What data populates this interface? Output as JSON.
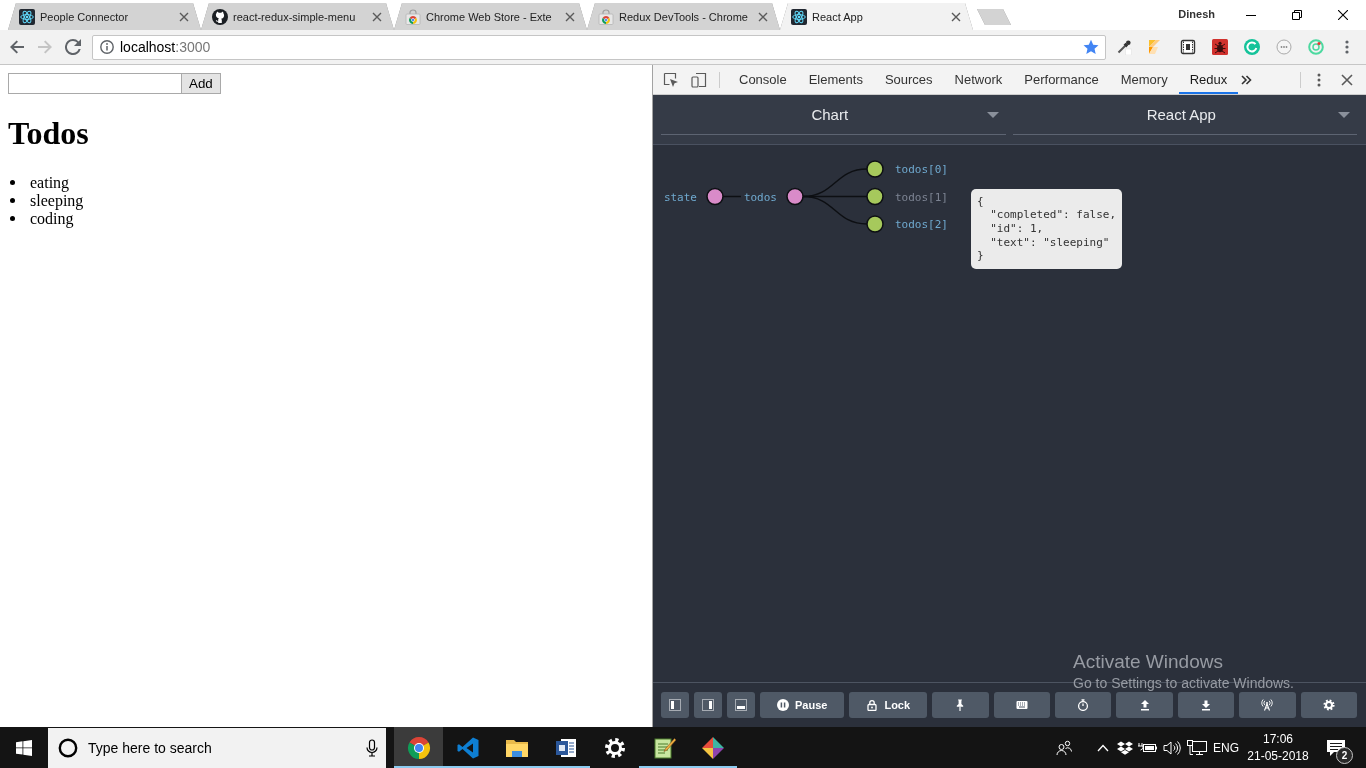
{
  "browser": {
    "tabs": [
      {
        "title": "People Connector",
        "kind": "atom",
        "selected": false
      },
      {
        "title": "react-redux-simple-menu",
        "kind": "cat",
        "selected": false
      },
      {
        "title": "Chrome Web Store - Exte",
        "kind": "bag",
        "selected": false
      },
      {
        "title": "Redux DevTools - Chrome",
        "kind": "bag",
        "selected": false
      },
      {
        "title": "React App",
        "kind": "atom",
        "selected": true
      }
    ],
    "profile": "Dinesh",
    "address": {
      "host": "localhost",
      "port": ":3000",
      "bookmarked": true
    },
    "extensions": [
      {
        "kind": "eyedropper"
      },
      {
        "kind": "fold"
      },
      {
        "kind": "frame"
      },
      {
        "kind": "bug"
      },
      {
        "kind": "arc"
      },
      {
        "kind": "dots"
      },
      {
        "kind": "target"
      }
    ]
  },
  "page": {
    "add_button": "Add",
    "heading": "Todos",
    "todos": [
      "eating",
      "sleeping",
      "coding"
    ]
  },
  "devtools": {
    "tabs": [
      {
        "label": "Console",
        "selected": false
      },
      {
        "label": "Elements",
        "selected": false
      },
      {
        "label": "Sources",
        "selected": false
      },
      {
        "label": "Network",
        "selected": false
      },
      {
        "label": "Performance",
        "selected": false
      },
      {
        "label": "Memory",
        "selected": false
      },
      {
        "label": "Redux",
        "selected": true
      }
    ],
    "redux": {
      "monitor": "Chart",
      "instance": "React App",
      "tree": {
        "name": "state",
        "hovered": false,
        "children": [
          {
            "name": "todos",
            "hovered": false,
            "children": [
              {
                "name": "todos[0]",
                "hovered": false
              },
              {
                "name": "todos[1]",
                "hovered": true
              },
              {
                "name": "todos[2]",
                "hovered": false
              }
            ]
          }
        ]
      },
      "tooltip": "{\n  \"completed\": false,\n  \"id\": 1,\n  \"text\": \"sleeping\"\n}",
      "buttons": [
        {
          "kind": "dock-left"
        },
        {
          "kind": "dock-right"
        },
        {
          "kind": "dock-bottom"
        },
        {
          "kind": "pause",
          "label": "Pause"
        },
        {
          "kind": "lock",
          "label": "Lock"
        },
        {
          "kind": "pin"
        },
        {
          "kind": "keyboard"
        },
        {
          "kind": "timer"
        },
        {
          "kind": "upload"
        },
        {
          "kind": "download"
        },
        {
          "kind": "remote"
        },
        {
          "kind": "settings"
        }
      ]
    }
  },
  "activation_notice": {
    "title": "Activate Windows",
    "text": "Go to Settings to activate Windows."
  },
  "taskbar": {
    "search_placeholder": "Type here to search",
    "apps": [
      {
        "kind": "browser",
        "active": true,
        "running": true
      },
      {
        "kind": "code",
        "active": false,
        "running": true
      },
      {
        "kind": "folder",
        "active": false,
        "running": true
      },
      {
        "kind": "document",
        "active": false,
        "running": true
      },
      {
        "kind": "gear",
        "active": false,
        "running": false
      },
      {
        "kind": "notepad",
        "active": false,
        "running": true
      },
      {
        "kind": "diamond",
        "active": false,
        "running": true
      }
    ],
    "language": "ENG",
    "time": "17:06",
    "date": "21-05-2018",
    "notifications": "2"
  }
}
